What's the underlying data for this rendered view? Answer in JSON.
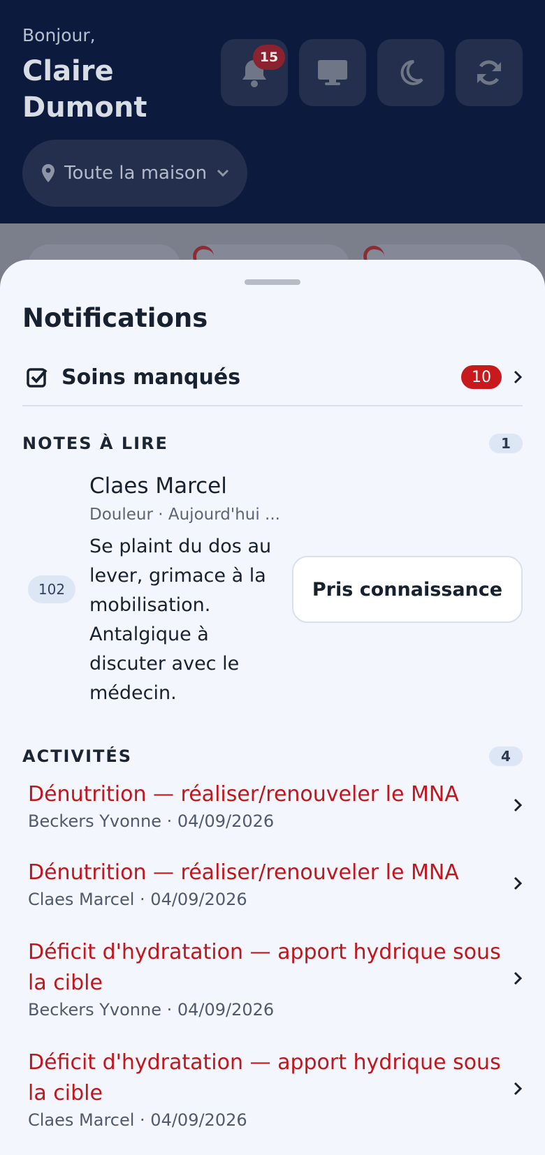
{
  "header": {
    "greeting": "Bonjour,",
    "user_name": "Claire Dumont",
    "notification_count": "15",
    "location": "Toute la maison"
  },
  "sheet": {
    "title": "Notifications",
    "missed_care": {
      "label": "Soins manqués",
      "count": "10"
    },
    "notes": {
      "heading": "NOTES À LIRE",
      "count": "1",
      "items": [
        {
          "room": "102",
          "patient": "Claes Marcel",
          "meta": "Douleur · Aujourd'hui ...",
          "text": "Se plaint du dos au lever, grimace à la mobilisation. Antalgique à discuter avec le médecin.",
          "action": "Pris connaissance"
        }
      ]
    },
    "activities": {
      "heading": "ACTIVITÉS",
      "count": "4",
      "items": [
        {
          "title": "Dénutrition — réaliser/renouveler le MNA",
          "subtitle": "Beckers Yvonne · 04/09/2026"
        },
        {
          "title": "Dénutrition — réaliser/renouveler le MNA",
          "subtitle": "Claes Marcel · 04/09/2026"
        },
        {
          "title": "Déficit d'hydratation — apport hydrique sous la cible",
          "subtitle": "Beckers Yvonne · 04/09/2026"
        },
        {
          "title": "Déficit d'hydratation — apport hydrique sous la cible",
          "subtitle": "Claes Marcel · 04/09/2026"
        }
      ]
    }
  },
  "colors": {
    "header_bg": "#0c1b3d",
    "sheet_bg": "#f3f6fc",
    "alert_red": "#c0161c",
    "badge_red": "#c8191d"
  },
  "icons": [
    "bell-icon",
    "monitor-icon",
    "moon-icon",
    "refresh-icon",
    "map-pin-icon",
    "chevron-down-icon",
    "checkbox-icon",
    "chevron-right-icon"
  ]
}
